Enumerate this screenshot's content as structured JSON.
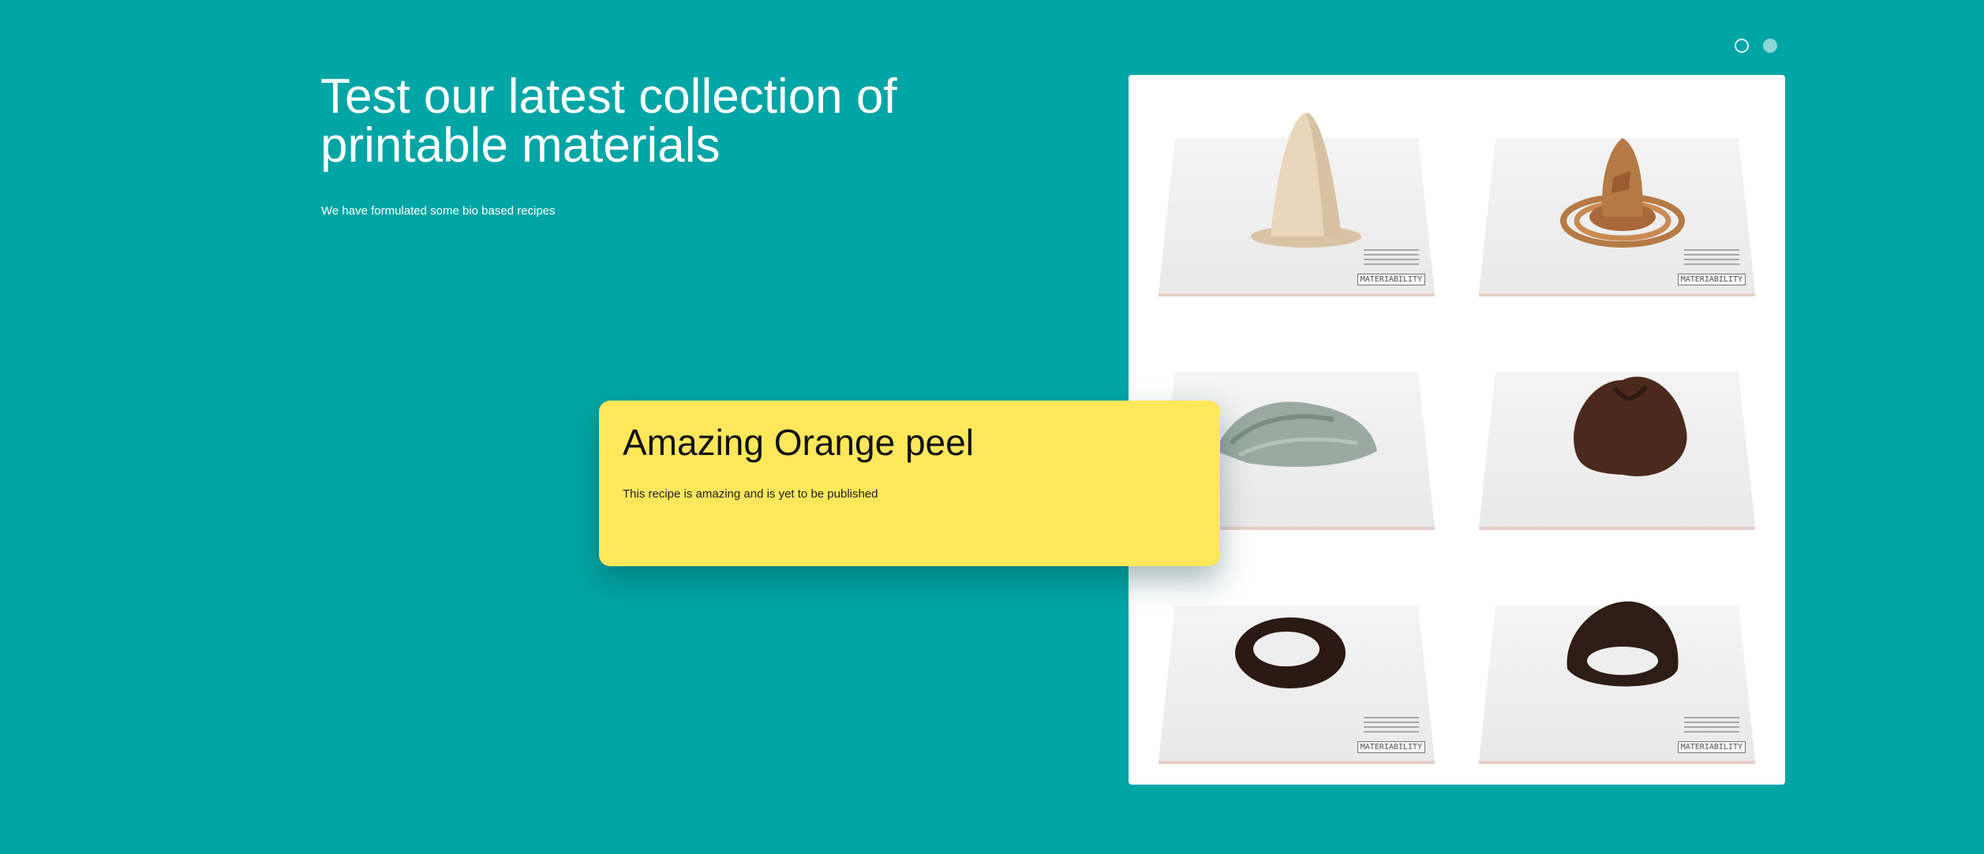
{
  "hero": {
    "title": "Test our latest collection of printable materials",
    "subtitle": "We have formulated some bio based recipes"
  },
  "carousel": {
    "slides": 2,
    "active_index": 0
  },
  "gallery": {
    "label": "MATERIABILITY"
  },
  "recipe_card": {
    "title": "Amazing Orange peel",
    "description": "This recipe is amazing and is yet to be published"
  },
  "colors": {
    "background": "#00a5a5",
    "card": "#ffe75c",
    "text_light": "#ffffff",
    "text_dark": "#111111"
  }
}
